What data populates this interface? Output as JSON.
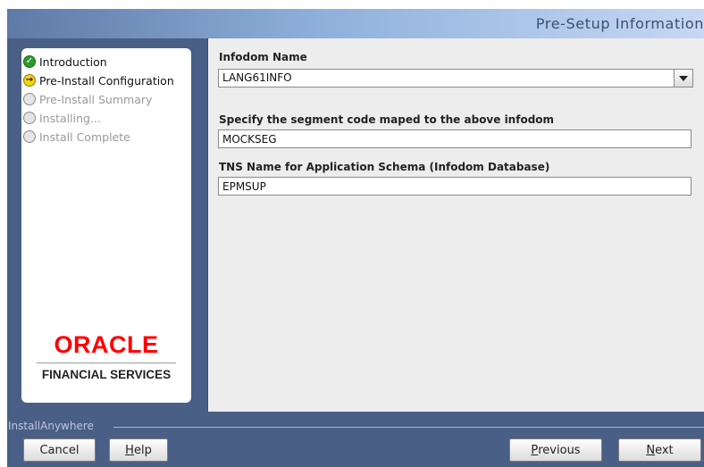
{
  "header": {
    "title": "Pre-Setup Information"
  },
  "steps": [
    {
      "label": "Introduction",
      "state": "done",
      "icon": "check-circle-icon"
    },
    {
      "label": "Pre-Install Configuration",
      "state": "current",
      "icon": "arrow-circle-icon"
    },
    {
      "label": "Pre-Install Summary",
      "state": "pending",
      "icon": "empty-circle-icon"
    },
    {
      "label": "Installing...",
      "state": "pending",
      "icon": "empty-circle-icon"
    },
    {
      "label": "Install Complete",
      "state": "pending",
      "icon": "empty-circle-icon"
    }
  ],
  "branding": {
    "logo_text": "ORACLE",
    "subtitle": "FINANCIAL SERVICES",
    "color": "#ff0000"
  },
  "form": {
    "infodom": {
      "label": "Infodom Name",
      "value": "LANG61INFO"
    },
    "segment": {
      "label": "Specify the segment code maped to the above infodom",
      "value": "MOCKSEG"
    },
    "tns": {
      "label": "TNS Name for Application Schema (Infodom Database)",
      "value": "EPMSUP"
    }
  },
  "footer": {
    "label": "InstallAnywhere"
  },
  "buttons": {
    "cancel": {
      "label": "Cancel"
    },
    "help": {
      "mnemonic": "H",
      "rest": "elp"
    },
    "previous": {
      "mnemonic": "P",
      "rest": "revious"
    },
    "next": {
      "mnemonic": "N",
      "rest": "ext"
    }
  },
  "colors": {
    "frame": "#4a5f86",
    "content_bg": "#ededed",
    "header_text": "#3d4f72"
  }
}
